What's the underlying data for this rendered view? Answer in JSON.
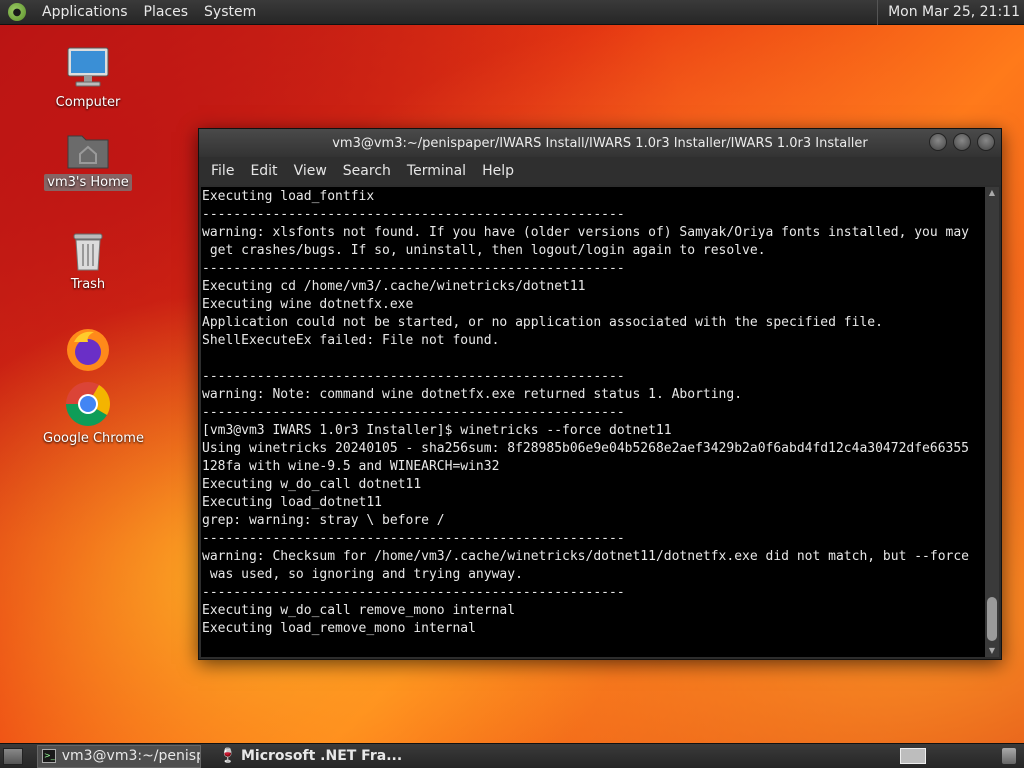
{
  "top_panel": {
    "menus": [
      "Applications",
      "Places",
      "System"
    ],
    "clock": "Mon Mar 25, 21:11"
  },
  "desktop": {
    "icons": [
      {
        "label": "Computer",
        "icon": "computer-icon"
      },
      {
        "label": "vm3's Home",
        "icon": "home-folder-icon"
      },
      {
        "label": "Trash",
        "icon": "trash-icon"
      },
      {
        "label": "Firefox",
        "icon": "firefox-icon"
      },
      {
        "label": "Google Chrome",
        "icon": "chrome-icon"
      }
    ]
  },
  "terminal": {
    "title": "vm3@vm3:~/penispaper/IWARS Install/IWARS 1.0r3 Installer/IWARS 1.0r3 Installer",
    "menu": [
      "File",
      "Edit",
      "View",
      "Search",
      "Terminal",
      "Help"
    ],
    "lines": [
      "Executing load_fontfix",
      "------------------------------------------------------",
      "warning: xlsfonts not found. If you have (older versions of) Samyak/Oriya fonts installed, you may",
      " get crashes/bugs. If so, uninstall, then logout/login again to resolve.",
      "------------------------------------------------------",
      "Executing cd /home/vm3/.cache/winetricks/dotnet11",
      "Executing wine dotnetfx.exe",
      "Application could not be started, or no application associated with the specified file.",
      "ShellExecuteEx failed: File not found.",
      "",
      "------------------------------------------------------",
      "warning: Note: command wine dotnetfx.exe returned status 1. Aborting.",
      "------------------------------------------------------",
      "[vm3@vm3 IWARS 1.0r3 Installer]$ winetricks --force dotnet11",
      "Using winetricks 20240105 - sha256sum: 8f28985b06e9e04b5268e2aef3429b2a0f6abd4fd12c4a30472dfe66355",
      "128fa with wine-9.5 and WINEARCH=win32",
      "Executing w_do_call dotnet11",
      "Executing load_dotnet11",
      "grep: warning: stray \\ before /",
      "------------------------------------------------------",
      "warning: Checksum for /home/vm3/.cache/winetricks/dotnet11/dotnetfx.exe did not match, but --force",
      " was used, so ignoring and trying anyway.",
      "------------------------------------------------------",
      "Executing w_do_call remove_mono internal",
      "Executing load_remove_mono internal"
    ]
  },
  "taskbar": {
    "tasks": [
      {
        "label": "vm3@vm3:~/penisp...",
        "icon": "terminal-icon",
        "active": true
      },
      {
        "label": "Microsoft .NET Fra...",
        "icon": "wine-icon",
        "active": false
      }
    ]
  }
}
